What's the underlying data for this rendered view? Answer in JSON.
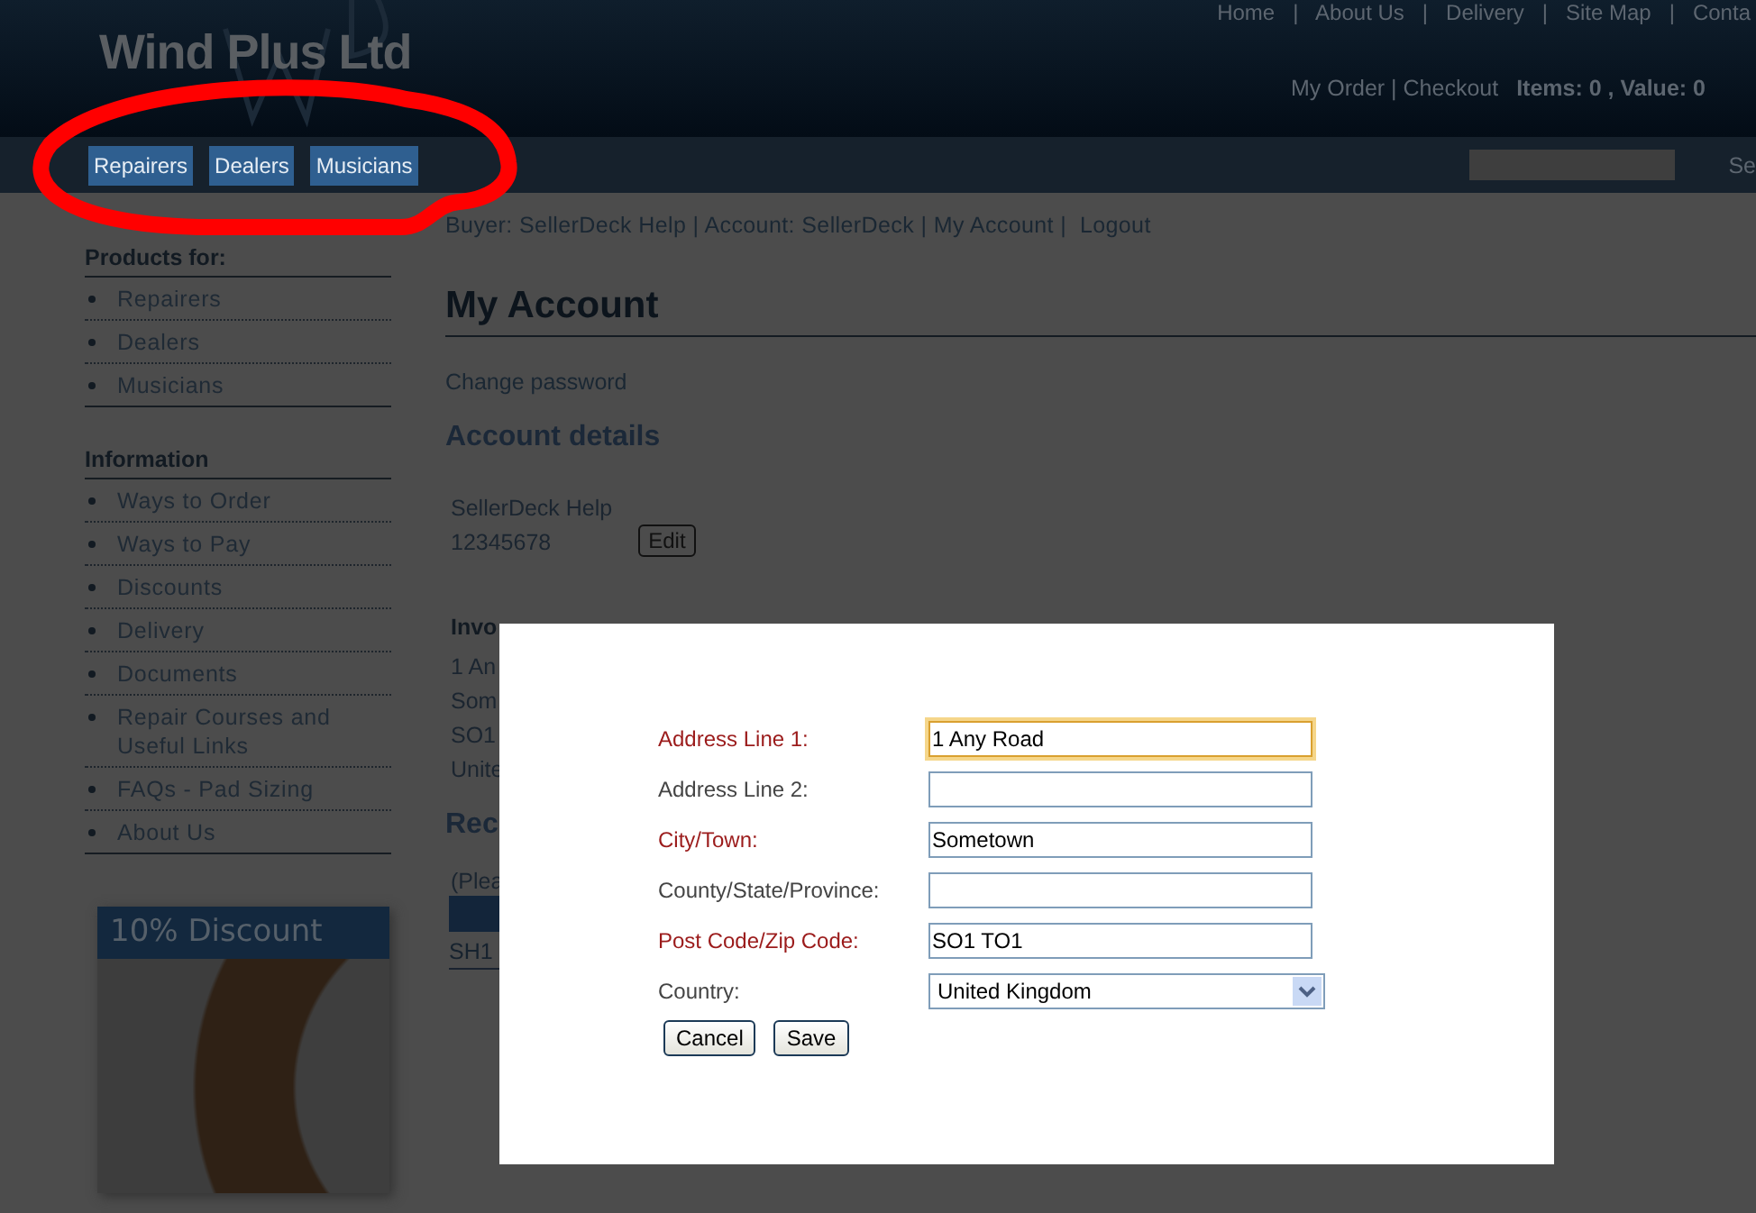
{
  "header": {
    "logo": "Wind Plus Ltd",
    "top_links": "Home   |   About Us   |   Delivery   |   Site Map   |   Conta",
    "cart_links": "My Order | Checkout",
    "cart_summary": "Items: 0 , Value: 0"
  },
  "nav": {
    "buttons": [
      "Repairers",
      "Dealers",
      "Musicians"
    ],
    "search_label": "Se"
  },
  "sidebar": {
    "sections": [
      {
        "title": "Products for:",
        "items": [
          "Repairers",
          "Dealers",
          "Musicians"
        ]
      },
      {
        "title": "Information",
        "items": [
          "Ways to Order",
          "Ways to Pay",
          "Discounts",
          "Delivery",
          "Documents",
          "Repair Courses and Useful Links",
          "FAQs - Pad Sizing",
          "About Us"
        ]
      }
    ],
    "promo": {
      "title": "10% Discount"
    }
  },
  "main": {
    "breadcrumb": "Buyer: SellerDeck Help | Account: SellerDeck | My Account |  Logout",
    "title": "My Account",
    "change_password": "Change password",
    "account_details": {
      "heading": "Account details",
      "name": "SellerDeck Help",
      "phone": "12345678",
      "edit_button": "Edit"
    },
    "invoice": {
      "heading": "Invo",
      "lines": [
        "1 An",
        "Som",
        "SO1",
        "Unite"
      ]
    },
    "recent": {
      "heading": "Rec",
      "note": "(Plea",
      "rows": [
        "SH1"
      ]
    }
  },
  "dialog": {
    "fields": [
      {
        "label": "Address Line 1:",
        "required": true,
        "kind": "text",
        "value": "1 Any Road",
        "focused": true
      },
      {
        "label": "Address Line 2:",
        "required": false,
        "kind": "text",
        "focused": false
      },
      {
        "label": "City/Town:",
        "required": true,
        "kind": "text",
        "value": "Sometown",
        "focused": false
      },
      {
        "label": "County/State/Province:",
        "required": false,
        "kind": "text",
        "focused": false
      },
      {
        "label": "Post Code/Zip Code:",
        "required": true,
        "kind": "text",
        "value": "SO1 TO1",
        "focused": false
      },
      {
        "label": "Country:",
        "required": false,
        "kind": "select",
        "value": "United Kingdom",
        "focused": false
      }
    ],
    "buttons": [
      "Cancel",
      "Save"
    ]
  }
}
